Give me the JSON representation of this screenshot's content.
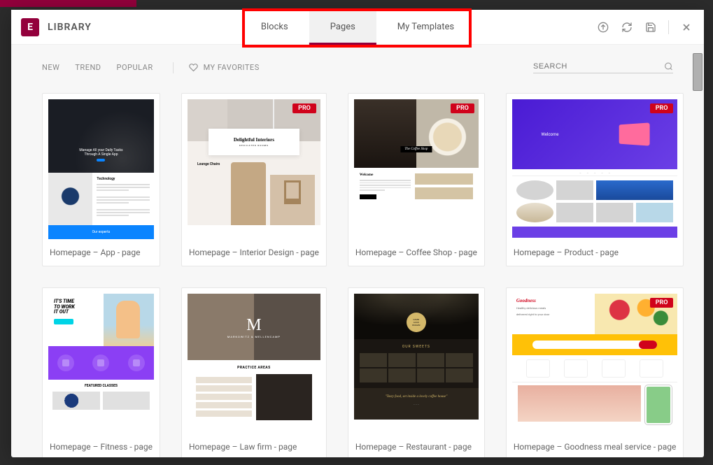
{
  "header": {
    "title": "LIBRARY",
    "logo_letter": "E"
  },
  "tabs": {
    "blocks": "Blocks",
    "pages": "Pages",
    "my_templates": "My Templates"
  },
  "filters": {
    "new": "NEW",
    "trend": "TREND",
    "popular": "POPULAR",
    "favorites": "MY FAVORITES"
  },
  "search": {
    "placeholder": "SEARCH"
  },
  "badge": {
    "pro": "PRO"
  },
  "templates": [
    {
      "caption": "Homepage – App - page",
      "pro": false
    },
    {
      "caption": "Homepage – Interior Design - page",
      "pro": true
    },
    {
      "caption": "Homepage – Coffee Shop - page",
      "pro": true
    },
    {
      "caption": "Homepage – Product - page",
      "pro": true
    },
    {
      "caption": "Homepage – Fitness - page",
      "pro": false
    },
    {
      "caption": "Homepage – Law firm - page",
      "pro": false
    },
    {
      "caption": "Homepage – Restaurant - page",
      "pro": false
    },
    {
      "caption": "Homepage – Goodness meal service - page",
      "pro": true
    }
  ],
  "thumbs": {
    "t1": {
      "hero_line1": "Manage All your Daily Tasks",
      "hero_line2": "Through A Single App",
      "tech": "Technology",
      "footer": "Our experts"
    },
    "t2": {
      "title": "Delightful Interiors",
      "subtitle": "DEDICATED ROOMS",
      "side": "Lounge Chairs"
    },
    "t3": {
      "tag": "The Coffee Shop",
      "welcome": "Welcome"
    },
    "t4": {
      "hero_t": "Welcome"
    },
    "t5": {
      "title": "IT'S TIME\nTO WORK\nIT OUT",
      "classes": "FEATURED CLASSES"
    },
    "t6": {
      "m": "M",
      "firm": "MARKOWITZ & MELLENCAMP",
      "areas": "PRACTICE AREAS"
    },
    "t7": {
      "burger1": "DAMN",
      "burger2": "GOOD",
      "burger3": "BURGER",
      "sweets": "OUR SWEETS",
      "quote": "\"Tasty food, set inside a lovely coffee house\""
    },
    "t8": {
      "logo": "Goodness",
      "tag1": "Healthy delicious meals",
      "tag2": "delivered right to your door"
    }
  }
}
